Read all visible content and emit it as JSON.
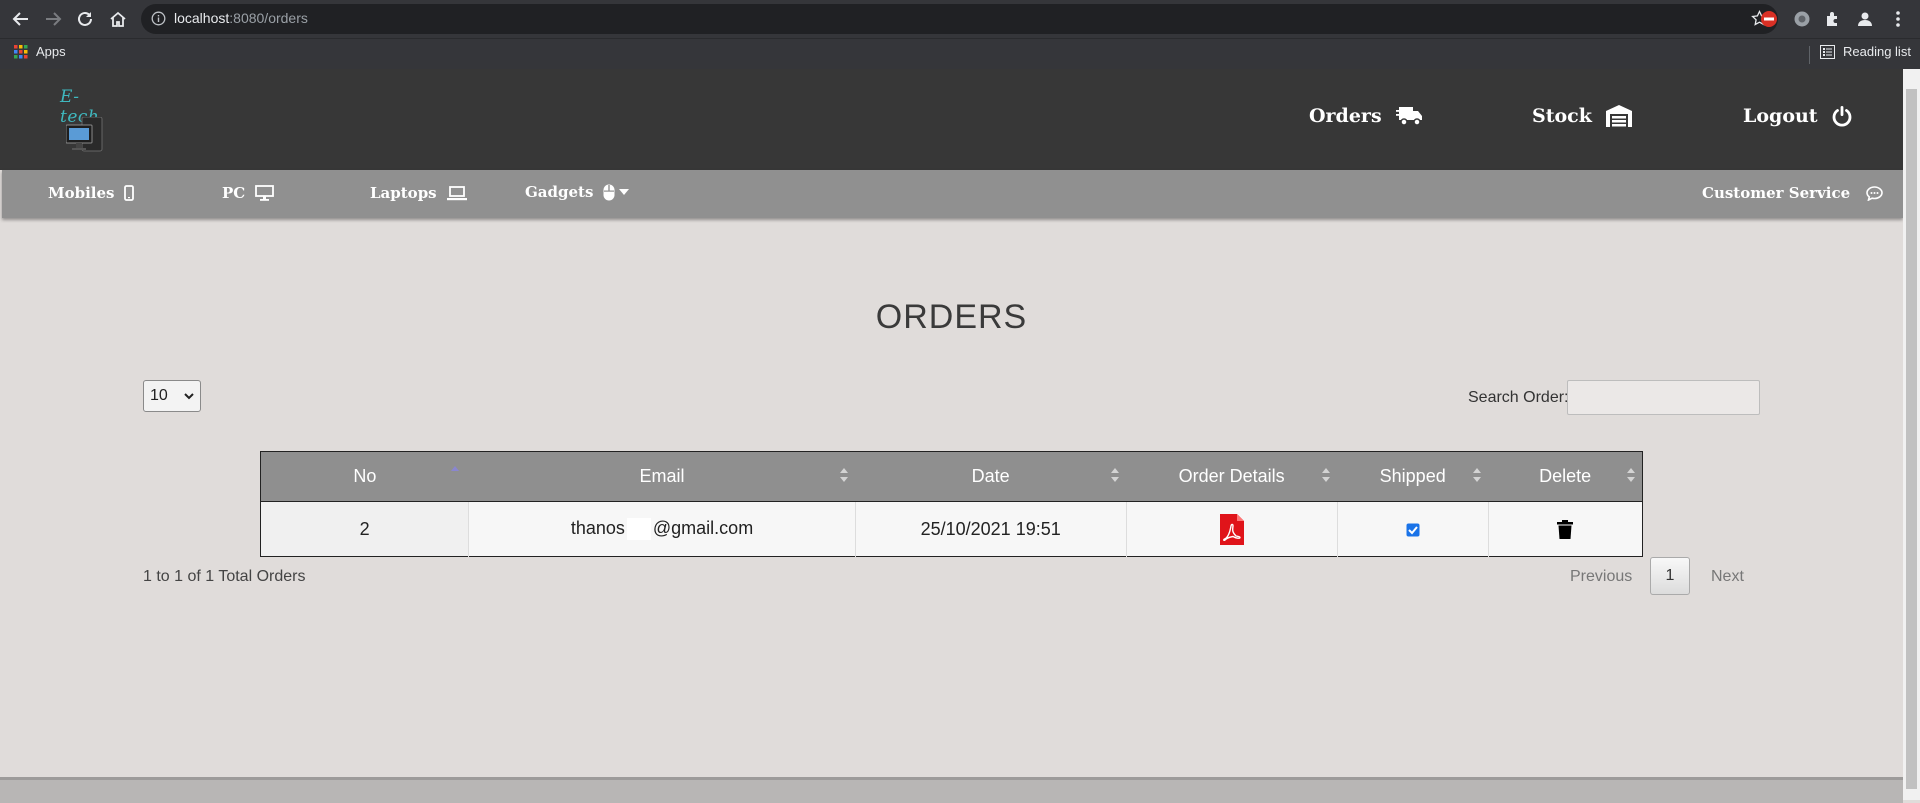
{
  "browser": {
    "url_host": "localhost",
    "url_path": ":8080/orders",
    "bookmarks": {
      "apps_label": "Apps",
      "reading_list_label": "Reading list"
    },
    "icons": [
      "back-icon",
      "forward-icon",
      "reload-icon",
      "home-icon",
      "info-icon",
      "star-icon",
      "extension-icon",
      "profile-icon",
      "menu-icon"
    ]
  },
  "header": {
    "logo_text": "E-tech",
    "nav": [
      {
        "label": "Orders",
        "icon": "truck-icon"
      },
      {
        "label": "Stock",
        "icon": "warehouse-icon"
      },
      {
        "label": "Logout",
        "icon": "power-icon"
      }
    ]
  },
  "categories": {
    "items": [
      {
        "label": "Mobiles",
        "icon": "mobile-icon"
      },
      {
        "label": "PC",
        "icon": "desktop-icon"
      },
      {
        "label": "Laptops",
        "icon": "laptop-icon"
      },
      {
        "label": "Gadgets",
        "icon": "mouse-icon"
      }
    ],
    "customer_service": {
      "label": "Customer Service",
      "icon": "chat-icon"
    }
  },
  "main": {
    "title": "ORDERS",
    "page_length": "10",
    "search_label": "Search Order:",
    "search_value": "",
    "columns": [
      "No",
      "Email",
      "Date",
      "Order Details",
      "Shipped",
      "Delete"
    ],
    "rows": [
      {
        "no": "2",
        "email_prefix": "thanos",
        "email_domain": "@gmail.com",
        "date": "25/10/2021 19:51",
        "shipped": true
      }
    ],
    "info": "1 to 1 of 1 Total Orders",
    "pagination": {
      "previous": "Previous",
      "page": "1",
      "next": "Next"
    }
  },
  "colors": {
    "header_bg": "#373737",
    "category_bg": "#909090",
    "page_bg": "#e0dcda",
    "logo_text": "#3fb8bf",
    "pdf_red": "#e0141a"
  }
}
